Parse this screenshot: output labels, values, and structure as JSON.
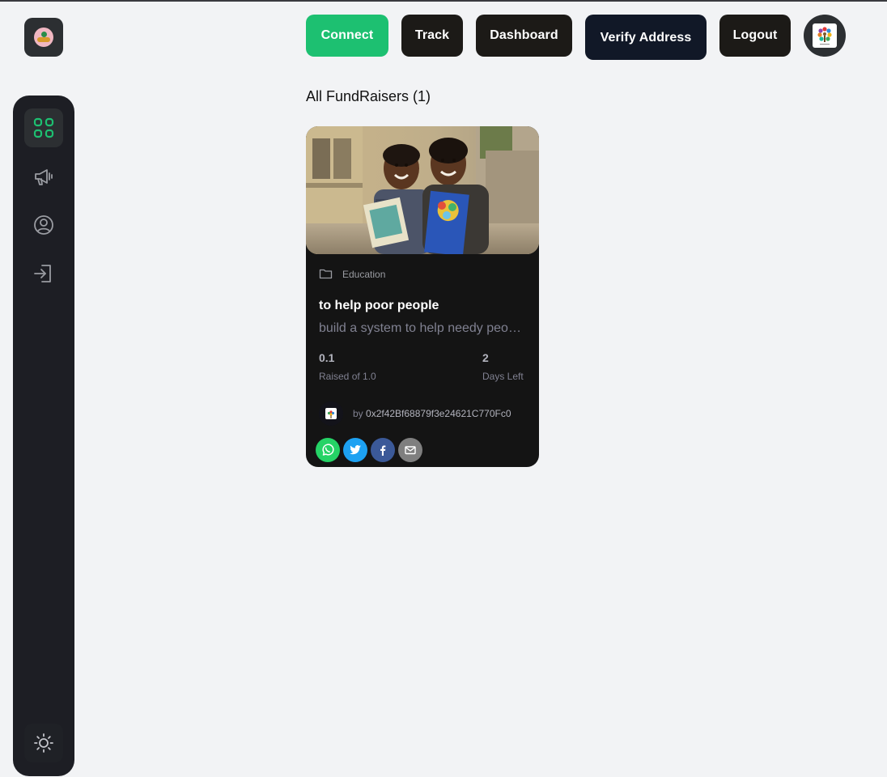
{
  "nav": {
    "connect": "Connect",
    "track": "Track",
    "dashboard": "Dashboard",
    "verify": "Verify Address",
    "logout": "Logout"
  },
  "sidebar": {
    "items": [
      {
        "name": "dashboard",
        "icon": "grid-icon",
        "active": true
      },
      {
        "name": "campaign",
        "icon": "megaphone-icon",
        "active": false
      },
      {
        "name": "profile",
        "icon": "user-circle-icon",
        "active": false
      },
      {
        "name": "login",
        "icon": "login-icon",
        "active": false
      }
    ],
    "theme_icon": "sun-icon"
  },
  "main": {
    "title": "All FundRaisers (1)"
  },
  "card": {
    "category": "Education",
    "title": "to help poor people",
    "description": "build a system to help needy people",
    "raised_value": "0.1",
    "raised_label": "Raised of 1.0",
    "days_value": "2",
    "days_label": "Days Left",
    "owner_prefix": "by ",
    "owner_address": "0x2f42Bf68879f3e24621C770Fc0"
  },
  "share": {
    "icons": [
      "whatsapp-icon",
      "twitter-icon",
      "facebook-icon",
      "email-icon"
    ]
  },
  "colors": {
    "accent": "#1dc071",
    "sidebar_bg": "#1d1e24",
    "card_bg": "#141414",
    "page_bg": "#f2f3f5"
  }
}
